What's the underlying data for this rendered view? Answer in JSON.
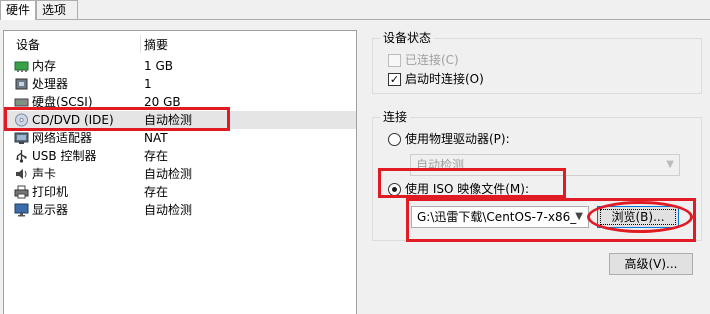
{
  "tabs": [
    {
      "label": "硬件"
    },
    {
      "label": "选项"
    }
  ],
  "device_list": {
    "col_device": "设备",
    "col_summary": "摘要",
    "rows": [
      {
        "icon": "memory-icon",
        "name": "内存",
        "summary": "1 GB"
      },
      {
        "icon": "processor-icon",
        "name": "处理器",
        "summary": "1"
      },
      {
        "icon": "hard-disk-icon",
        "name": "硬盘(SCSI)",
        "summary": "20 GB"
      },
      {
        "icon": "cd-dvd-icon",
        "name": "CD/DVD (IDE)",
        "summary": "自动检测",
        "selected": true
      },
      {
        "icon": "network-adapter-icon",
        "name": "网络适配器",
        "summary": "NAT"
      },
      {
        "icon": "usb-icon",
        "name": "USB 控制器",
        "summary": "存在"
      },
      {
        "icon": "sound-card-icon",
        "name": "声卡",
        "summary": "自动检测"
      },
      {
        "icon": "printer-icon",
        "name": "打印机",
        "summary": "存在"
      },
      {
        "icon": "display-icon",
        "name": "显示器",
        "summary": "自动检测"
      }
    ]
  },
  "device_status": {
    "title": "设备状态",
    "connected_label": "已连接(C)",
    "connected_checked": false,
    "connected_enabled": false,
    "connect_on_power_label": "启动时连接(O)",
    "connect_on_power_checked": true
  },
  "connection": {
    "title": "连接",
    "physical_drive_label": "使用物理驱动器(P):",
    "physical_drive_selected": false,
    "physical_drive_value": "自动检测",
    "iso_label": "使用 ISO 映像文件(M):",
    "iso_selected": true,
    "iso_path": "G:\\迅雷下载\\CentOS-7-x86_",
    "browse_label": "浏览(B)..."
  },
  "advanced_label": "高级(V)...",
  "colors": {
    "highlight": "#e01b24",
    "selected_row": "#e5e5e5",
    "focus_border": "#0078d7"
  }
}
